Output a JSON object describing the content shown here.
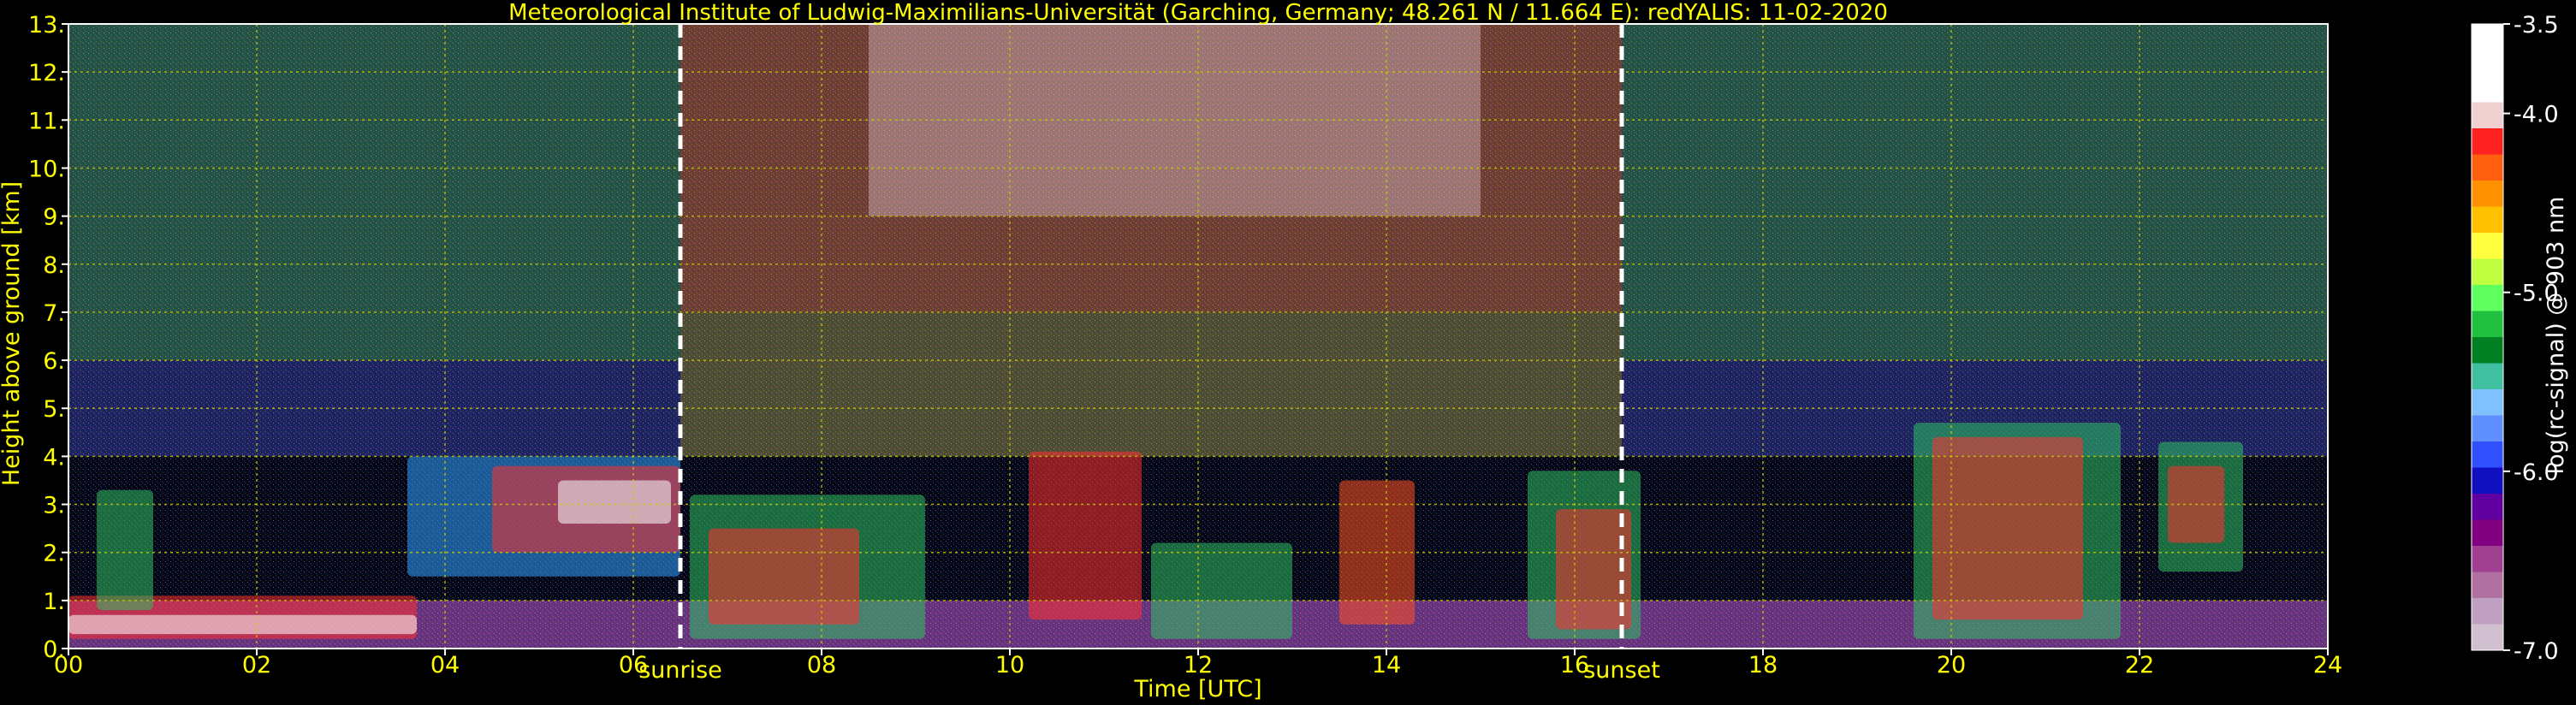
{
  "chart_data": {
    "type": "heatmap",
    "title": "Meteorological Institute of Ludwig-Maximilians-Universität (Garching, Germany; 48.261 N / 11.664 E):    redYALIS: 11-02-2020",
    "xlabel": "Time [UTC]",
    "ylabel": "Height above ground [km]",
    "xlim": [
      0,
      24
    ],
    "ylim": [
      0,
      13
    ],
    "x_ticks": [
      "00",
      "02",
      "04",
      "06",
      "08",
      "10",
      "12",
      "14",
      "16",
      "18",
      "20",
      "22",
      "24"
    ],
    "y_ticks": [
      "0.",
      "1.",
      "2.",
      "3.",
      "4.",
      "5.",
      "6.",
      "7.",
      "8.",
      "9.",
      "10.",
      "11.",
      "12.",
      "13."
    ],
    "grid": true,
    "colorbar": {
      "label": "log(rc-signal) @ 903 nm",
      "range": [
        -7.0,
        -3.5
      ],
      "ticks": [
        "-3.5",
        "-4.0",
        "-5.0",
        "-6.0",
        "-7.0"
      ]
    },
    "annotations": [
      {
        "label": "sunrise",
        "x": 6.5
      },
      {
        "label": "sunset",
        "x": 16.5
      }
    ],
    "colors": {
      "text": "#ffff00",
      "grid": "#c8c800",
      "cb_text": "#ffffff"
    }
  }
}
